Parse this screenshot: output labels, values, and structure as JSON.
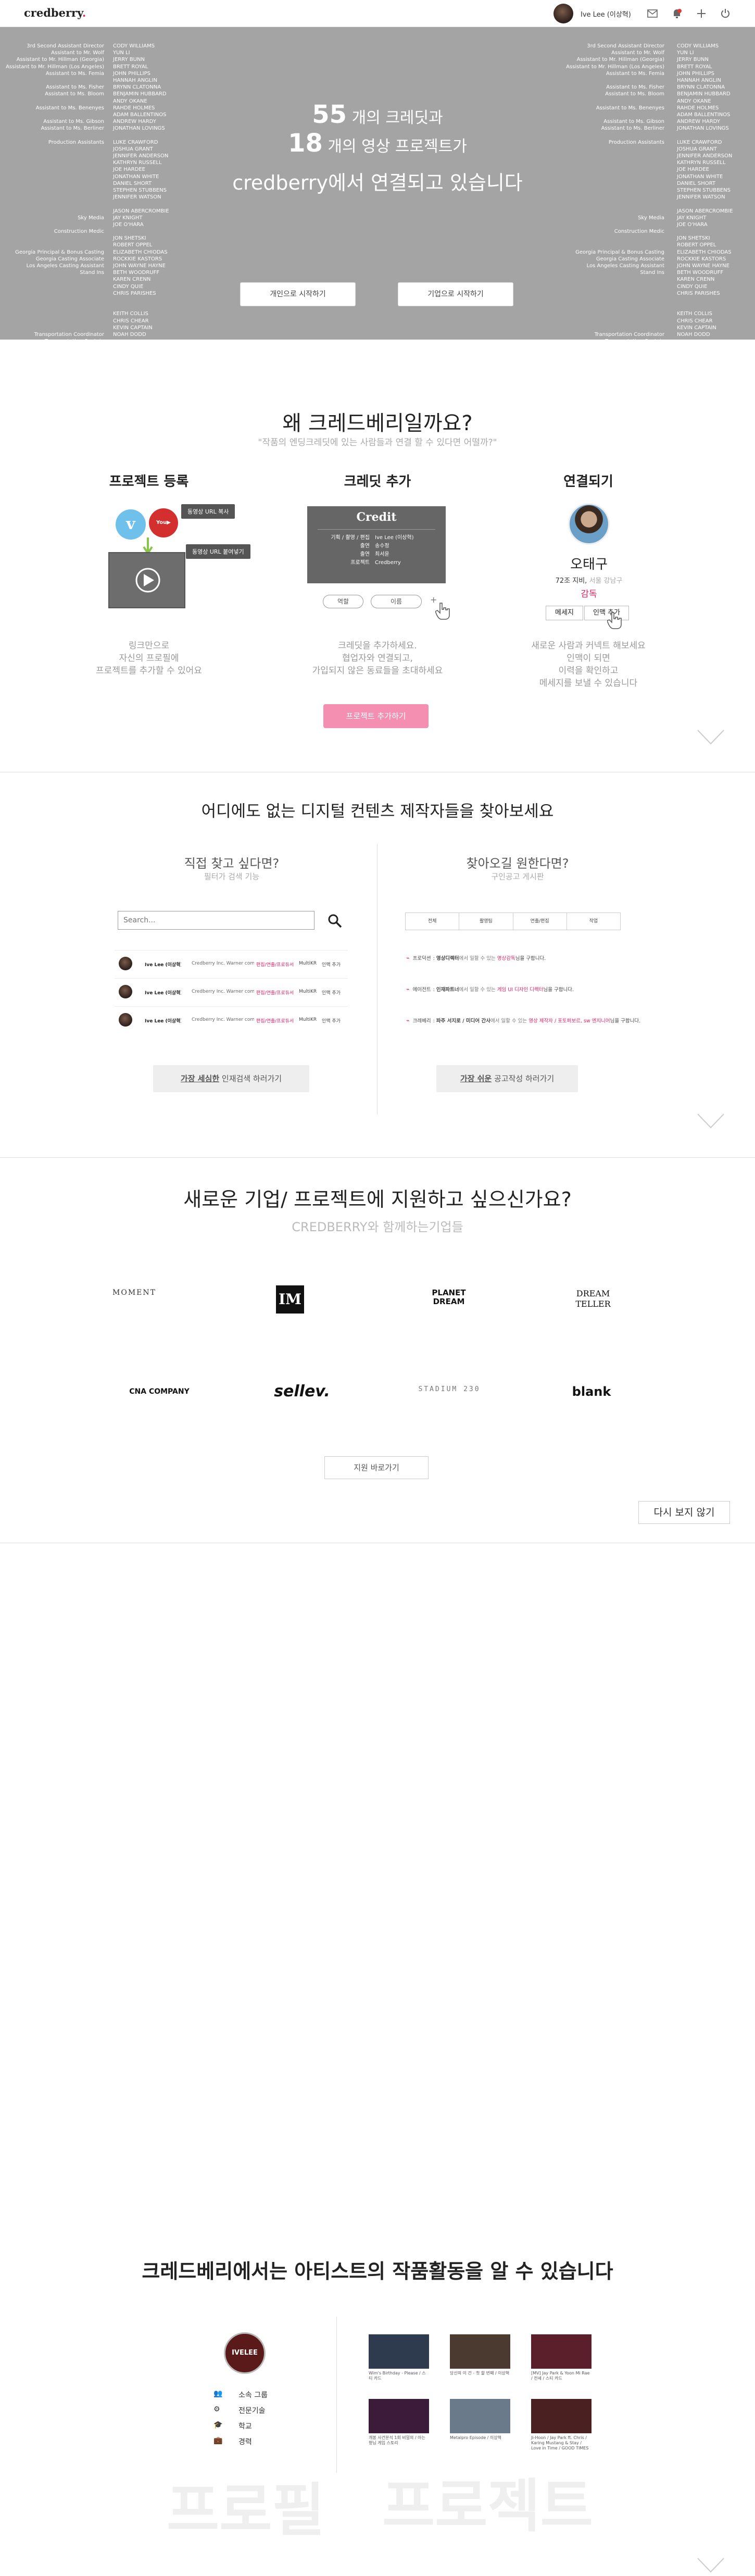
{
  "header": {
    "logo": "credberry",
    "logo_dot": ".",
    "user_name": "Ive Lee (이상혁)",
    "icons": [
      "mail-icon",
      "notification-icon",
      "plus-icon",
      "power-icon"
    ]
  },
  "hero": {
    "credit_roles": [
      "3rd Second Assistant Director",
      "Assistant to Mr. Wolf",
      "Assistant to Mr. Hillman (Georgia)",
      "Assistant to Mr. Hillman (Los Angeles)",
      "Assistant to Ms. Femia",
      "",
      "Assistant to Ms. Fisher",
      "Assistant to Ms. Bloom",
      "",
      "Assistant to Ms. Benenyes",
      "",
      "Assistant to Ms. Gibson",
      "Assistant to Ms. Berliner",
      "",
      "Production Assistants",
      "",
      "",
      "",
      "",
      "",
      "",
      "",
      "",
      "",
      "",
      "Sky Media",
      "",
      "Construction Medic",
      "",
      "",
      "Georgia Principal & Bonus Casting",
      "Georgia Casting Associate",
      "Los Angeles Casting Assistant",
      "Stand Ins",
      "",
      "",
      "",
      "",
      "",
      "",
      "",
      "",
      "Transportation Coordinator",
      "Transportation Captain"
    ],
    "credit_names": [
      "CODY WILLIAMS",
      "YUN LI",
      "JERRY BUNN",
      "BRETT ROYAL",
      "JOHN PHILLIPS",
      "HANNAH ANGLIN",
      "BRYNN CLATONNA",
      "BENJAMIN HUBBARD",
      "ANDY OKANE",
      "RAHDE HOLMES",
      "ADAM BALLENTINOS",
      "ANDREW HARDY",
      "JONATHAN LOVINGS",
      "",
      "LUKE CRAWFORD",
      "JOSHUA GRANT",
      "JENNIFER ANDERSON",
      "KATHRYN RUSSELL",
      "JOE HARDEE",
      "JONATHAN WHITE",
      "DANIEL SHORT",
      "STEPHEN STUBBENS",
      "JENNIFER WATSON",
      "",
      "JASON ABERCROMBIE",
      "JAY KNIGHT",
      "JOE O'HARA",
      "",
      "JON SHETSKI",
      "ROBERT OPPEL",
      "ELIZABETH CHIODAS",
      "ROCKKIE KASTORS",
      "JOHN WAYNE HAYNE",
      "BETH WOODRUFF",
      "KAREN CRENN",
      "CINDY QUIE",
      "CHRIS PARISHES",
      "",
      "",
      "KEITH COLLIS",
      "CHRIS CHEAR",
      "KEVIN CAPTAIN",
      "NOAH DODD"
    ],
    "count_projects": "55",
    "line1_suffix": "개의 크레딧과",
    "count_videos": "18",
    "line2_suffix": "개의 영상 프로젝트가",
    "line3": "credberry에서 연결되고 있습니다",
    "btn_personal": "개인으로 시작하기",
    "btn_company": "기업으로 시작하기"
  },
  "why": {
    "title": "왜 크레드베리일까요?",
    "subtitle": "\"작품의 엔딩크레딧에 있는 사람들과 연결 할 수 있다면 어떨까?\"",
    "col1": {
      "title": "프로젝트 등록",
      "pill_a": "동영상 URL 복사",
      "pill_b": "동영상 URL 붙여넣기",
      "desc1": "링크만으로",
      "desc2": "자신의 프로필에",
      "desc3": "프로젝트를 추가할 수 있어요"
    },
    "col2": {
      "title": "크레딧 추가",
      "card_title": "Credit",
      "card_rows": [
        [
          "기획 / 촬영 / 편집",
          "Ive Lee (이상혁)"
        ],
        [
          "출연",
          "송수정"
        ],
        [
          "출연",
          "최서윤"
        ],
        [
          "프로젝트",
          "Credberry"
        ]
      ],
      "chip_role": "역할",
      "chip_name": "이름",
      "chip_add": "+",
      "desc1": "크레딧을 추가하세요.",
      "desc2": "협업자와 연결되고,",
      "desc3": "가입되지 않은 동료들을 초대하세요"
    },
    "col3": {
      "title": "연결되기",
      "person_name": "오태구",
      "meta": "72조 지비, ",
      "meta_gray": "서울 강남구",
      "role": "감독",
      "btn_message": "메세지",
      "btn_connect": "인맥 추가",
      "desc1": "새로운 사람과 커넥트 해보세요",
      "desc2": "인맥이 되면",
      "desc3": "이력을 확인하고",
      "desc4": "메세지를 보낼 수 있습니다"
    },
    "cta": "프로젝트 추가하기"
  },
  "find": {
    "title": "어디에도 없는 디지털 컨텐츠 제작자들을 찾아보세요",
    "left_title": "직접 찾고 싶다면?",
    "left_sub": "필터가 검색 기능",
    "search_placeholder": "Search...",
    "rows": [
      [
        "Ive Lee (이상혁)",
        "Credberry Inc. Warner company",
        "편집/연출/프로듀서",
        "MultiKR",
        "인맥 추가"
      ],
      [
        "Ive Lee (이상혁)",
        "Credberry Inc. Warner company",
        "편집/연출/프로듀서",
        "MultiKR",
        "인맥 추가"
      ],
      [
        "Ive Lee (이상혁)",
        "Credberry Inc. Warner company",
        "편집/연출/프로듀서",
        "MultiKR",
        "인맥 추가"
      ]
    ],
    "left_btn_em": "가장 세심한",
    "left_btn_rest": " 인재검색 하러가기",
    "right_title": "찾아오길 원한다면?",
    "right_sub": "구인공고 게시판",
    "tabs": [
      "전체",
      "촬영팀",
      "연출/편집",
      "작업"
    ],
    "posts": [
      [
        "프로덕션",
        "영상디렉터",
        "에서 일할 수 있는 ",
        "영상감독",
        "님을 구합니다."
      ],
      [
        "에이전트",
        "인재파트너",
        "에서 일할 수 있는 ",
        "게임 UI 디자인 디렉터",
        "님을 구합니다."
      ],
      [
        "크레베리",
        "파주 서지로 / 미디어 간사",
        "에서 일할 수 있는 ",
        "영상 제작자 / 포토퍼보르, sw 엔지니어",
        "님을 구합니다."
      ]
    ],
    "right_btn_em": "가장 쉬운",
    "right_btn_rest": " 공고작성 하러가기"
  },
  "apply": {
    "title": "새로운 기업/ 프로젝트에 지원하고 싶으신가요?",
    "subtitle": "CREDBERRY와 함께하는기업들",
    "companies": [
      "MOMENT",
      "IM",
      "PLANET DREAM",
      "DREAM TELLER",
      "CNA COMPANY",
      "sellev.",
      "STADIUM 230",
      "blank"
    ],
    "btn": "지원 바로가기",
    "dismiss": "다시 보지 않기"
  },
  "artist": {
    "title": "크레드베리에서는 아티스트의 작품활동을 알 수 있습니다",
    "avatar_text": "IVELEE",
    "profile_items": [
      "소속 그룹",
      "전문기술",
      "학교",
      "경력"
    ],
    "thumbs": [
      "Wim's Birthday - Please / 스티 카드",
      "당신의 이 건 - 첫 할 번째 / 이상혁",
      "[MV] Jay Park & Yoon Mi Rae / 전세 / 스티 카드",
      "개봉 사건분석 1회 비밀의 / 아는 형님 게임 스토리",
      "Metalpro Episode / 이상혁",
      "Ji-Hoon / Jay Park ft. Chris / Karing Mustang & Stay / Love in Time / GOOD TIMES"
    ],
    "word_profile": "프로필",
    "word_project": "프로젝트"
  }
}
